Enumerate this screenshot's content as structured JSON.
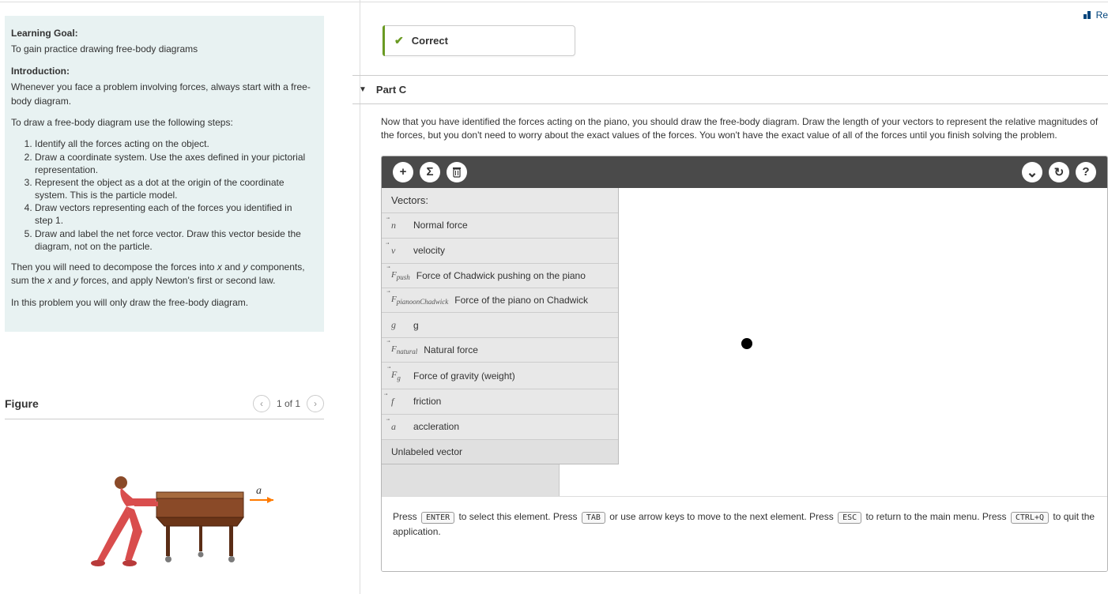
{
  "topLink": "Re",
  "learningGoal": {
    "heading": "Learning Goal:",
    "goalText": "To gain practice drawing free-body diagrams",
    "introHeading": "Introduction:",
    "intro1": "Whenever you face a problem involving forces, always start with a free-body diagram.",
    "intro2": "To draw a free-body diagram use the following steps:",
    "steps": [
      "Identify all the forces acting on the object.",
      "Draw a coordinate system. Use the axes defined in your pictorial representation.",
      "Represent the object as a dot at the origin of the coordinate system. This is the particle model.",
      "Draw vectors representing each of the forces you identified in step 1.",
      "Draw and label the net force vector. Draw this vector beside the diagram, not on the particle."
    ],
    "after1_a": "Then you will need to decompose the forces into ",
    "after1_x": "x",
    "after1_b": " and ",
    "after1_y": "y",
    "after1_c": " components, sum the ",
    "after1_d": " forces, and apply Newton's first or second law.",
    "after2": "In this problem you will only draw the free-body diagram."
  },
  "figure": {
    "title": "Figure",
    "counter": "1 of 1",
    "accelLabel": "a"
  },
  "status": {
    "label": "Correct"
  },
  "partC": {
    "label": "Part C",
    "instructions": "Now that you have identified the forces acting on the piano, you should draw the free-body diagram. Draw the length of your vectors to represent the relative magnitudes of the forces, but you don't need to worry about the exact values of the forces. You won't have the exact value of all of the forces until you finish solving the problem."
  },
  "vectorsPanel": {
    "title": "Vectors:",
    "items": [
      {
        "sym": "n⃗",
        "label": "Normal force"
      },
      {
        "sym": "v⃗",
        "label": "velocity"
      },
      {
        "sym": "F⃗_push",
        "label": "Force of Chadwick pushing on the piano"
      },
      {
        "sym": "F⃗_pianoonChadwick",
        "label": "Force of the piano on Chadwick"
      },
      {
        "sym": "g",
        "label": "g"
      },
      {
        "sym": "F⃗_natural",
        "label": "Natural force"
      },
      {
        "sym": "F⃗_g",
        "label": "Force of gravity (weight)"
      },
      {
        "sym": "f⃗",
        "label": "friction"
      },
      {
        "sym": "a⃗",
        "label": "accleration"
      },
      {
        "sym": "",
        "label": "Unlabeled vector"
      }
    ]
  },
  "hints": {
    "press": "Press ",
    "enter": "ENTER",
    "t1": " to select this element. Press ",
    "tab": "TAB",
    "t2": " or use arrow keys to move to the next element. Press ",
    "esc": "ESC",
    "t3": " to return to the main menu. Press ",
    "ctrlq": "CTRL+Q",
    "t4": " to quit the application."
  },
  "toolbarIcons": {
    "add": "+",
    "sigma": "Σ",
    "trash": "🗑",
    "down": "⌄",
    "undo": "↻",
    "help": "?"
  }
}
